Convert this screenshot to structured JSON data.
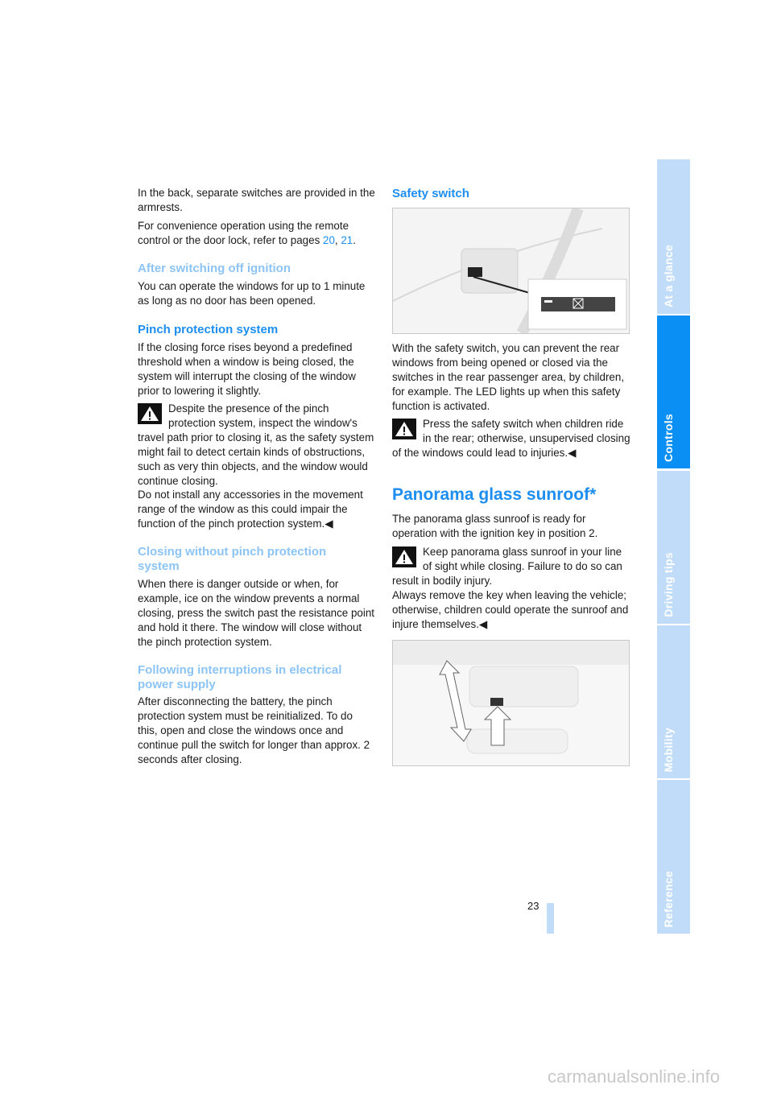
{
  "left": {
    "p1": "In the back, separate switches are provided in the armrests.",
    "p2_pre": "For convenience operation using the remote control or the door lock, refer to pages ",
    "p2_link1": "20",
    "p2_sep": ", ",
    "p2_link2": "21",
    "p2_post": ".",
    "h_after": "After switching off ignition",
    "p_after": "You can operate the windows for up to 1 minute as long as no door has been opened.",
    "h_pinch": "Pinch protection system",
    "p_pinch": "If the closing force rises beyond a predefined threshold when a window is being closed, the system will interrupt the closing of the window prior to lowering it slightly.",
    "warn_pinch_1": "Despite the presence of the pinch protection system, inspect the window's travel path prior to closing it, as the safety system might fail to detect certain kinds of obstructions, such as very thin objects, and the window would continue closing.",
    "warn_pinch_2": "Do not install any accessories in the movement range of the window as this could impair the function of the pinch protection system.◀",
    "h_closing": "Closing without pinch protection system",
    "p_closing": "When there is danger outside or when, for example, ice on the window prevents a normal closing, press the switch past the resistance point and hold it there. The window will close without the pinch protection system.",
    "h_following": "Following interruptions in electrical power supply",
    "p_following": "After disconnecting the battery, the pinch protection system must be reinitialized. To do this, open and close the windows once and continue pull the switch for longer than approx. 2 seconds after closing."
  },
  "right": {
    "h_safety": "Safety switch",
    "p_safety": "With the safety switch, you can prevent the rear windows from being opened or closed via the switches in the rear passenger area, by children, for example. The LED lights up when this safety function is activated.",
    "warn_safety": "Press the safety switch when children ride in the rear; otherwise, unsupervised closing of the windows could lead to injuries.◀",
    "h_panorama": "Panorama glass sunroof*",
    "p_panorama": "The panorama glass sunroof is ready for operation with the ignition key in position 2.",
    "warn_panorama_1": "Keep panorama glass sunroof in your line of sight while closing. Failure to do so can result in bodily injury.",
    "warn_panorama_2": "Always remove the key when leaving the vehicle; otherwise, children could operate the sunroof and injure themselves.◀"
  },
  "sidebar": {
    "tabs": [
      {
        "label": "At a glance",
        "active": false
      },
      {
        "label": "Controls",
        "active": true
      },
      {
        "label": "Driving tips",
        "active": false
      },
      {
        "label": "Mobility",
        "active": false
      },
      {
        "label": "Reference",
        "active": false
      }
    ]
  },
  "page_number": "23",
  "watermark": "carmanualsonline.info",
  "colors": {
    "accent": "#1d8ef0",
    "accent_light": "#8cc4f5",
    "tab_active": "#0a8ff5",
    "tab_inactive": "#c0dcf8"
  }
}
